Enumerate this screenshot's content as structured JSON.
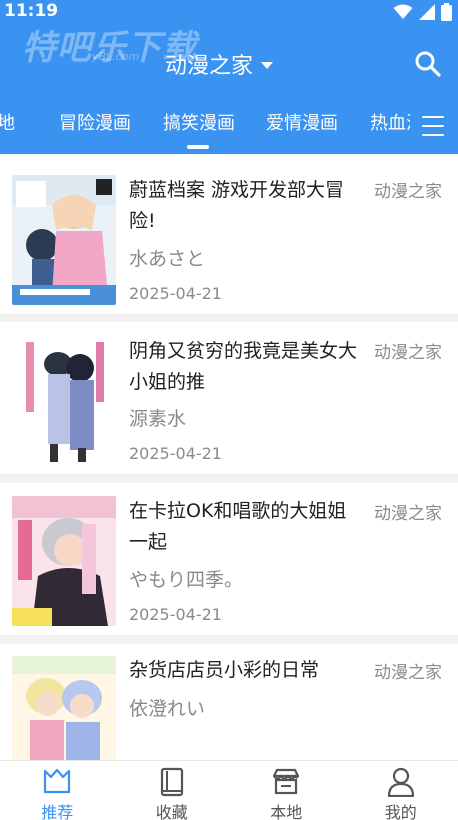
{
  "status_bar": {
    "time": "11:19"
  },
  "header": {
    "watermark": "特吧乐下载",
    "watermark_sub": "yBL.com",
    "title": "动漫之家",
    "accent_color": "#3a93f0"
  },
  "tabs": [
    {
      "label": "本地"
    },
    {
      "label": "冒险漫画"
    },
    {
      "label": "搞笑漫画",
      "active": true
    },
    {
      "label": "爱情漫画"
    },
    {
      "label": "热血漫画"
    }
  ],
  "comics": [
    {
      "title": "蔚蓝档案 游戏开发部大冒险!",
      "author": "水あさと",
      "date": "2025-04-21",
      "source": "动漫之家",
      "cover_icon": "comic-cover-blue-archive"
    },
    {
      "title": "阴角又贫穷的我竟是美女大小姐的推",
      "author": "源素水",
      "date": "2025-04-21",
      "source": "动漫之家",
      "cover_icon": "comic-cover-inkya"
    },
    {
      "title": "在卡拉OK和唱歌的大姐姐一起",
      "author": "やもり四季。",
      "date": "2025-04-21",
      "source": "动漫之家",
      "cover_icon": "comic-cover-karaoke"
    },
    {
      "title": "杂货店店员小彩的日常",
      "author": "依澄れい",
      "date": "",
      "source": "动漫之家",
      "cover_icon": "comic-cover-zakka"
    }
  ],
  "bottom_nav": [
    {
      "label": "推荐",
      "active": true,
      "icon": "recommend-icon"
    },
    {
      "label": "收藏",
      "icon": "bookshelf-icon"
    },
    {
      "label": "本地",
      "icon": "store-icon"
    },
    {
      "label": "我的",
      "icon": "profile-icon"
    }
  ]
}
